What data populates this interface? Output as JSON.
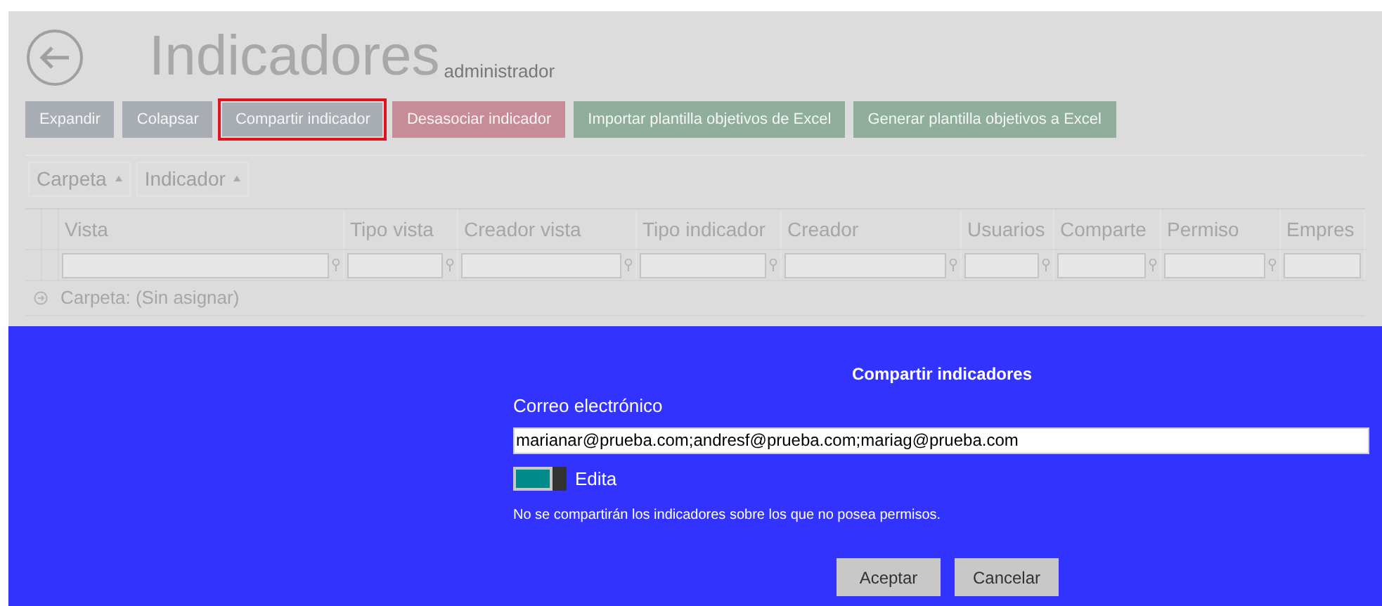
{
  "header": {
    "title": "Indicadores",
    "subtitle": "administrador"
  },
  "toolbar": [
    {
      "label": "Expandir",
      "kind": "neutral",
      "focused": false
    },
    {
      "label": "Colapsar",
      "kind": "neutral",
      "focused": false
    },
    {
      "label": "Compartir indicador",
      "kind": "neutral",
      "focused": true
    },
    {
      "label": "Desasociar indicador",
      "kind": "danger",
      "focused": false
    },
    {
      "label": "Importar plantilla objetivos de Excel",
      "kind": "success",
      "focused": false
    },
    {
      "label": "Generar plantilla objetivos a Excel",
      "kind": "success",
      "focused": false
    }
  ],
  "group_by": [
    "Carpeta",
    "Indicador"
  ],
  "table": {
    "columns": [
      "Vista",
      "Tipo vista",
      "Creador vista",
      "Tipo indicador",
      "Creador",
      "Usuarios",
      "Comparte",
      "Permiso",
      "Empres"
    ],
    "groups": [
      "Carpeta: (Sin asignar)"
    ]
  },
  "dialog": {
    "title": "Compartir indicadores",
    "email_label": "Correo electrónico",
    "email_value": "marianar@prueba.com;andresf@prueba.com;mariag@prueba.com",
    "edit_toggle": {
      "label": "Edita",
      "on": true
    },
    "note": "No se compartirán los indicadores sobre los que no posea permisos.",
    "buttons": [
      "Aceptar",
      "Cancelar"
    ]
  }
}
